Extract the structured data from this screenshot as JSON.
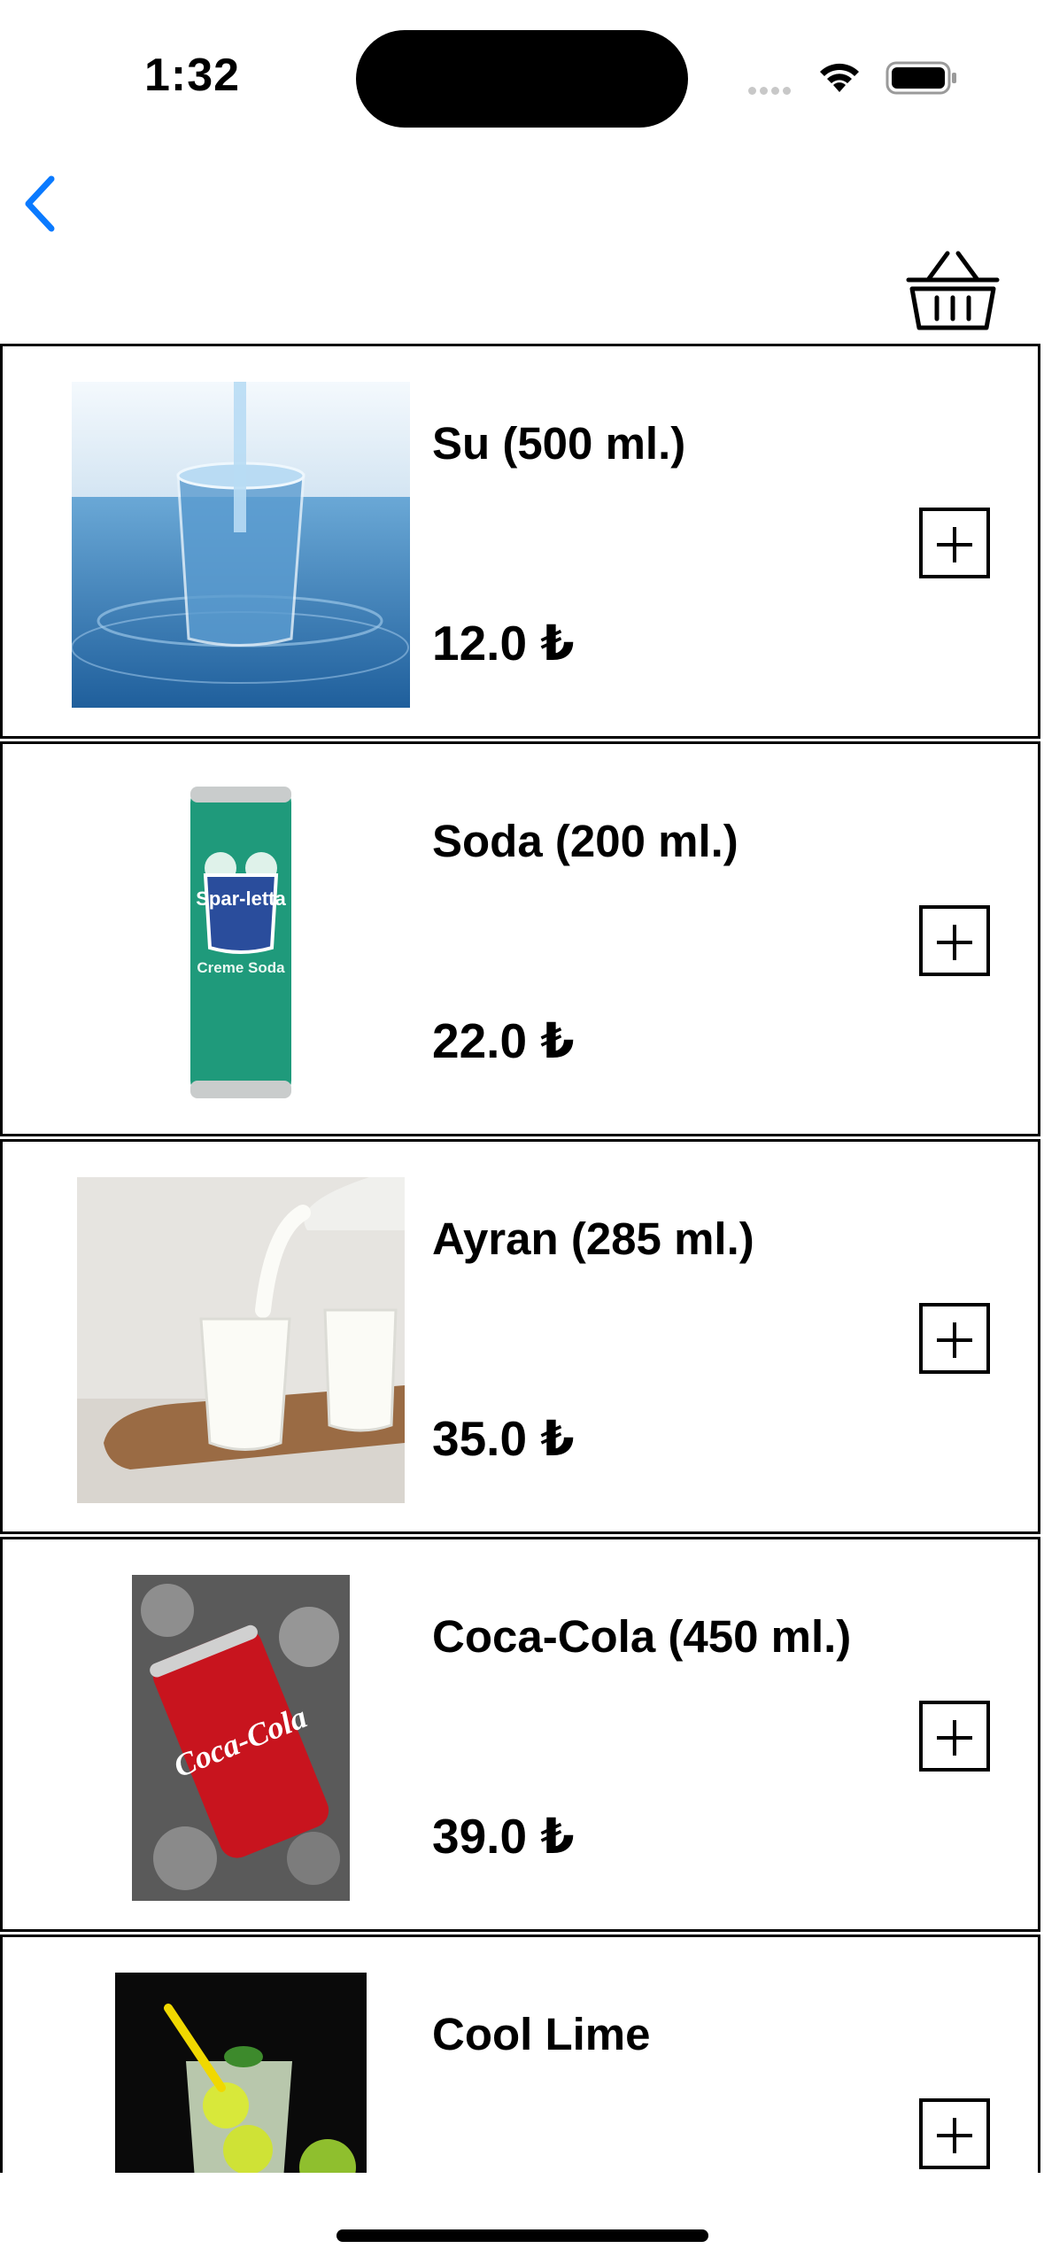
{
  "status": {
    "time": "1:32"
  },
  "colors": {
    "accent": "#0a7aff"
  },
  "products": [
    {
      "name": "Su (500 ml.)",
      "price": "12.0 ₺",
      "image": "water-glass-photo"
    },
    {
      "name": "Soda (200 ml.)",
      "price": "22.0 ₺",
      "image": "soda-can-photo",
      "can_brand": "Spar-letta",
      "can_flavor": "Creme Soda"
    },
    {
      "name": "Ayran (285 ml.)",
      "price": "35.0 ₺",
      "image": "ayran-glasses-photo"
    },
    {
      "name": "Coca-Cola (450 ml.)",
      "price": "39.0 ₺",
      "image": "coca-cola-can-photo",
      "can_brand": "Coca-Cola"
    },
    {
      "name": "Cool Lime",
      "price": "",
      "image": "cool-lime-drink-photo"
    }
  ]
}
